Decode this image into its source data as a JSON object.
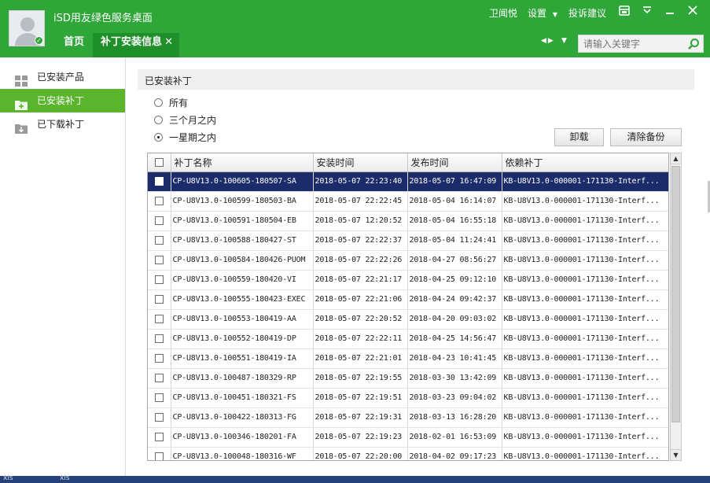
{
  "header": {
    "app_title": "iSD用友绿色服务桌面",
    "user_name": "卫闻悦",
    "settings_label": "设置",
    "feedback_label": "投诉建议",
    "tabs": [
      {
        "label": "首页"
      },
      {
        "label": "补丁安装信息",
        "close": "✕"
      }
    ],
    "search_placeholder": "请输入关键字"
  },
  "sidebar": {
    "items": [
      {
        "label": "已安装产品",
        "icon": "grid-icon"
      },
      {
        "label": "已安装补丁",
        "icon": "folder-add-icon",
        "active": true
      },
      {
        "label": "已下载补丁",
        "icon": "folder-download-icon"
      }
    ]
  },
  "content": {
    "section_title": "已安装补丁",
    "filters": [
      {
        "label": "所有",
        "selected": false
      },
      {
        "label": "三个月之内",
        "selected": false
      },
      {
        "label": "一星期之内",
        "selected": true
      }
    ],
    "buttons": {
      "uninstall": "卸载",
      "clear_backup": "清除备份"
    },
    "table": {
      "columns": [
        "补丁名称",
        "安装时间",
        "发布时间",
        "依赖补丁"
      ],
      "rows": [
        {
          "name": "CP-U8V13.0-100605-180507-SA",
          "installed": "2018-05-07 22:23:40",
          "published": "2018-05-07 16:47:09",
          "depends": "KB-U8V13.0-000001-171130-Interf...",
          "selected": true
        },
        {
          "name": "CP-U8V13.0-100599-180503-BA",
          "installed": "2018-05-07 22:22:45",
          "published": "2018-05-04 16:14:07",
          "depends": "KB-U8V13.0-000001-171130-Interf..."
        },
        {
          "name": "CP-U8V13.0-100591-180504-EB",
          "installed": "2018-05-07 12:20:52",
          "published": "2018-05-04 16:55:18",
          "depends": "KB-U8V13.0-000001-171130-Interf..."
        },
        {
          "name": "CP-U8V13.0-100588-180427-ST",
          "installed": "2018-05-07 22:22:37",
          "published": "2018-05-04 11:24:41",
          "depends": "KB-U8V13.0-000001-171130-Interf..."
        },
        {
          "name": "CP-U8V13.0-100584-180426-PUOM",
          "installed": "2018-05-07 22:22:26",
          "published": "2018-04-27 08:56:27",
          "depends": "KB-U8V13.0-000001-171130-Interf..."
        },
        {
          "name": "CP-U8V13.0-100559-180420-VI",
          "installed": "2018-05-07 22:21:17",
          "published": "2018-04-25 09:12:10",
          "depends": "KB-U8V13.0-000001-171130-Interf..."
        },
        {
          "name": "CP-U8V13.0-100555-180423-EXEC",
          "installed": "2018-05-07 22:21:06",
          "published": "2018-04-24 09:42:37",
          "depends": "KB-U8V13.0-000001-171130-Interf..."
        },
        {
          "name": "CP-U8V13.0-100553-180419-AA",
          "installed": "2018-05-07 22:20:52",
          "published": "2018-04-20 09:03:02",
          "depends": "KB-U8V13.0-000001-171130-Interf..."
        },
        {
          "name": "CP-U8V13.0-100552-180419-DP",
          "installed": "2018-05-07 22:22:11",
          "published": "2018-04-25 14:56:47",
          "depends": "KB-U8V13.0-000001-171130-Interf..."
        },
        {
          "name": "CP-U8V13.0-100551-180419-IA",
          "installed": "2018-05-07 22:21:01",
          "published": "2018-04-23 10:41:45",
          "depends": "KB-U8V13.0-000001-171130-Interf..."
        },
        {
          "name": "CP-U8V13.0-100487-180329-RP",
          "installed": "2018-05-07 22:19:55",
          "published": "2018-03-30 13:42:09",
          "depends": "KB-U8V13.0-000001-171130-Interf..."
        },
        {
          "name": "CP-U8V13.0-100451-180321-FS",
          "installed": "2018-05-07 22:19:51",
          "published": "2018-03-23 09:04:02",
          "depends": "KB-U8V13.0-000001-171130-Interf..."
        },
        {
          "name": "CP-U8V13.0-100422-180313-FG",
          "installed": "2018-05-07 22:19:31",
          "published": "2018-03-13 16:28:20",
          "depends": "KB-U8V13.0-000001-171130-Interf..."
        },
        {
          "name": "CP-U8V13.0-100346-180201-FA",
          "installed": "2018-05-07 22:19:23",
          "published": "2018-02-01 16:53:09",
          "depends": "KB-U8V13.0-000001-171130-Interf..."
        },
        {
          "name": "CP-U8V13.0-100048-180316-WF",
          "installed": "2018-05-07 22:20:00",
          "published": "2018-04-02 09:17:23",
          "depends": "KB-U8V13.0-000001-171130-Interf..."
        }
      ]
    }
  },
  "taskbar": {
    "items": [
      "xls",
      "xls"
    ]
  },
  "colors": {
    "header_green": "#2fa638",
    "active_tab": "#1f8f2a",
    "sidebar_active": "#5ab52d",
    "row_selected": "#1c2c6a"
  }
}
